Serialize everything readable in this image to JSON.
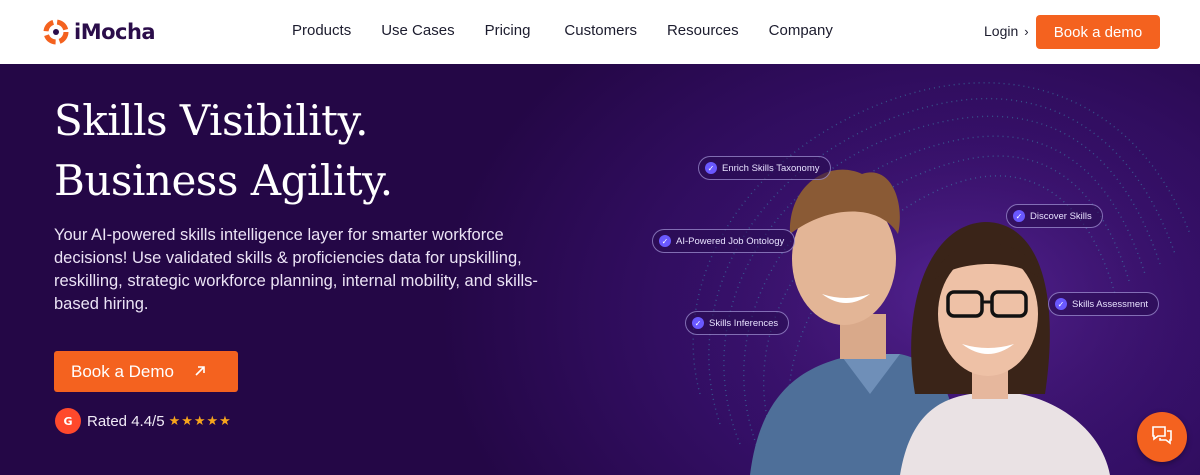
{
  "header": {
    "logo_text": "iMocha",
    "nav": [
      "Products",
      "Use Cases",
      "Pricing",
      "Customers",
      "Resources",
      "Company"
    ],
    "login_label": "Login",
    "cta_label": "Book a demo"
  },
  "hero": {
    "headline_line1": "Skills Visibility.",
    "headline_line2": "Business Agility.",
    "subtext": "Your AI-powered skills intelligence layer for smarter workforce decisions! Use validated skills & proficiencies data for upskilling, reskilling, strategic workforce planning, internal mobility, and skills-based hiring.",
    "cta_label": "Book a Demo",
    "rating_badge": "G",
    "rating_text": "Rated 4.4/5",
    "rating_stars": "★★★★★"
  },
  "skill_chips": [
    "Enrich Skills Taxonomy",
    "Discover Skills",
    "AI-Powered Job Ontology",
    "Skills Assessment",
    "Skills Inferences"
  ],
  "colors": {
    "accent": "#f4621f",
    "hero_bg": "#2a0a4a",
    "brand_dark": "#2b0d4a",
    "stars": "#f7a51c"
  },
  "icons": [
    "imocha-logo-icon",
    "chevron-right-icon",
    "arrow-up-right-icon",
    "g2-icon",
    "check-icon",
    "chat-icon"
  ]
}
